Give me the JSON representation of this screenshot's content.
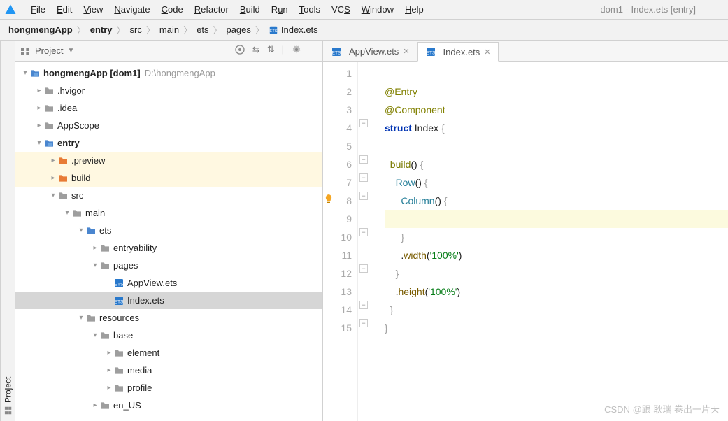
{
  "window": {
    "title": "dom1 - Index.ets [entry]"
  },
  "menu": {
    "file": "File",
    "edit": "Edit",
    "view": "View",
    "navigate": "Navigate",
    "code": "Code",
    "refactor": "Refactor",
    "build": "Build",
    "run": "Run",
    "tools": "Tools",
    "vcs": "VCS",
    "window": "Window",
    "help": "Help"
  },
  "breadcrumb": [
    "hongmengApp",
    "entry",
    "src",
    "main",
    "ets",
    "pages",
    "Index.ets"
  ],
  "toolWindow": {
    "title": "Project"
  },
  "sideTab": {
    "label": "Project"
  },
  "tree": {
    "root": {
      "name": "hongmengApp",
      "suffix": "[dom1]",
      "hint": "D:\\hongmengApp"
    },
    "hvigor": ".hvigor",
    "idea": ".idea",
    "appscope": "AppScope",
    "entry": "entry",
    "preview": ".preview",
    "build": "build",
    "src": "src",
    "main": "main",
    "ets": "ets",
    "entryability": "entryability",
    "pages": "pages",
    "appview": "AppView.ets",
    "index": "Index.ets",
    "resources": "resources",
    "base": "base",
    "element": "element",
    "media": "media",
    "profile": "profile",
    "enus": "en_US"
  },
  "tabs": {
    "t1": "AppView.ets",
    "t2": "Index.ets"
  },
  "code": {
    "l2": "@Entry",
    "l3": "@Component",
    "l4a": "struct",
    "l4b": " Index ",
    "l4c": "{",
    "l6a": "build",
    "l6b": "() ",
    "l6c": "{",
    "l7a": "Row",
    "l7b": "() ",
    "l7c": "{",
    "l8a": "Column",
    "l8b": "() ",
    "l8c": "{",
    "l10": "}",
    "l11a": ".",
    "l11b": "width",
    "l11c": "(",
    "l11d": "'100%'",
    "l11e": ")",
    "l12": "}",
    "l13a": ".",
    "l13b": "height",
    "l13c": "(",
    "l13d": "'100%'",
    "l13e": ")",
    "l14": "}",
    "l15": "}"
  },
  "gutter": [
    "1",
    "2",
    "3",
    "4",
    "5",
    "6",
    "7",
    "8",
    "9",
    "10",
    "11",
    "12",
    "13",
    "14",
    "15"
  ],
  "watermark": "CSDN @跟 耿瑞 卷出一片天"
}
